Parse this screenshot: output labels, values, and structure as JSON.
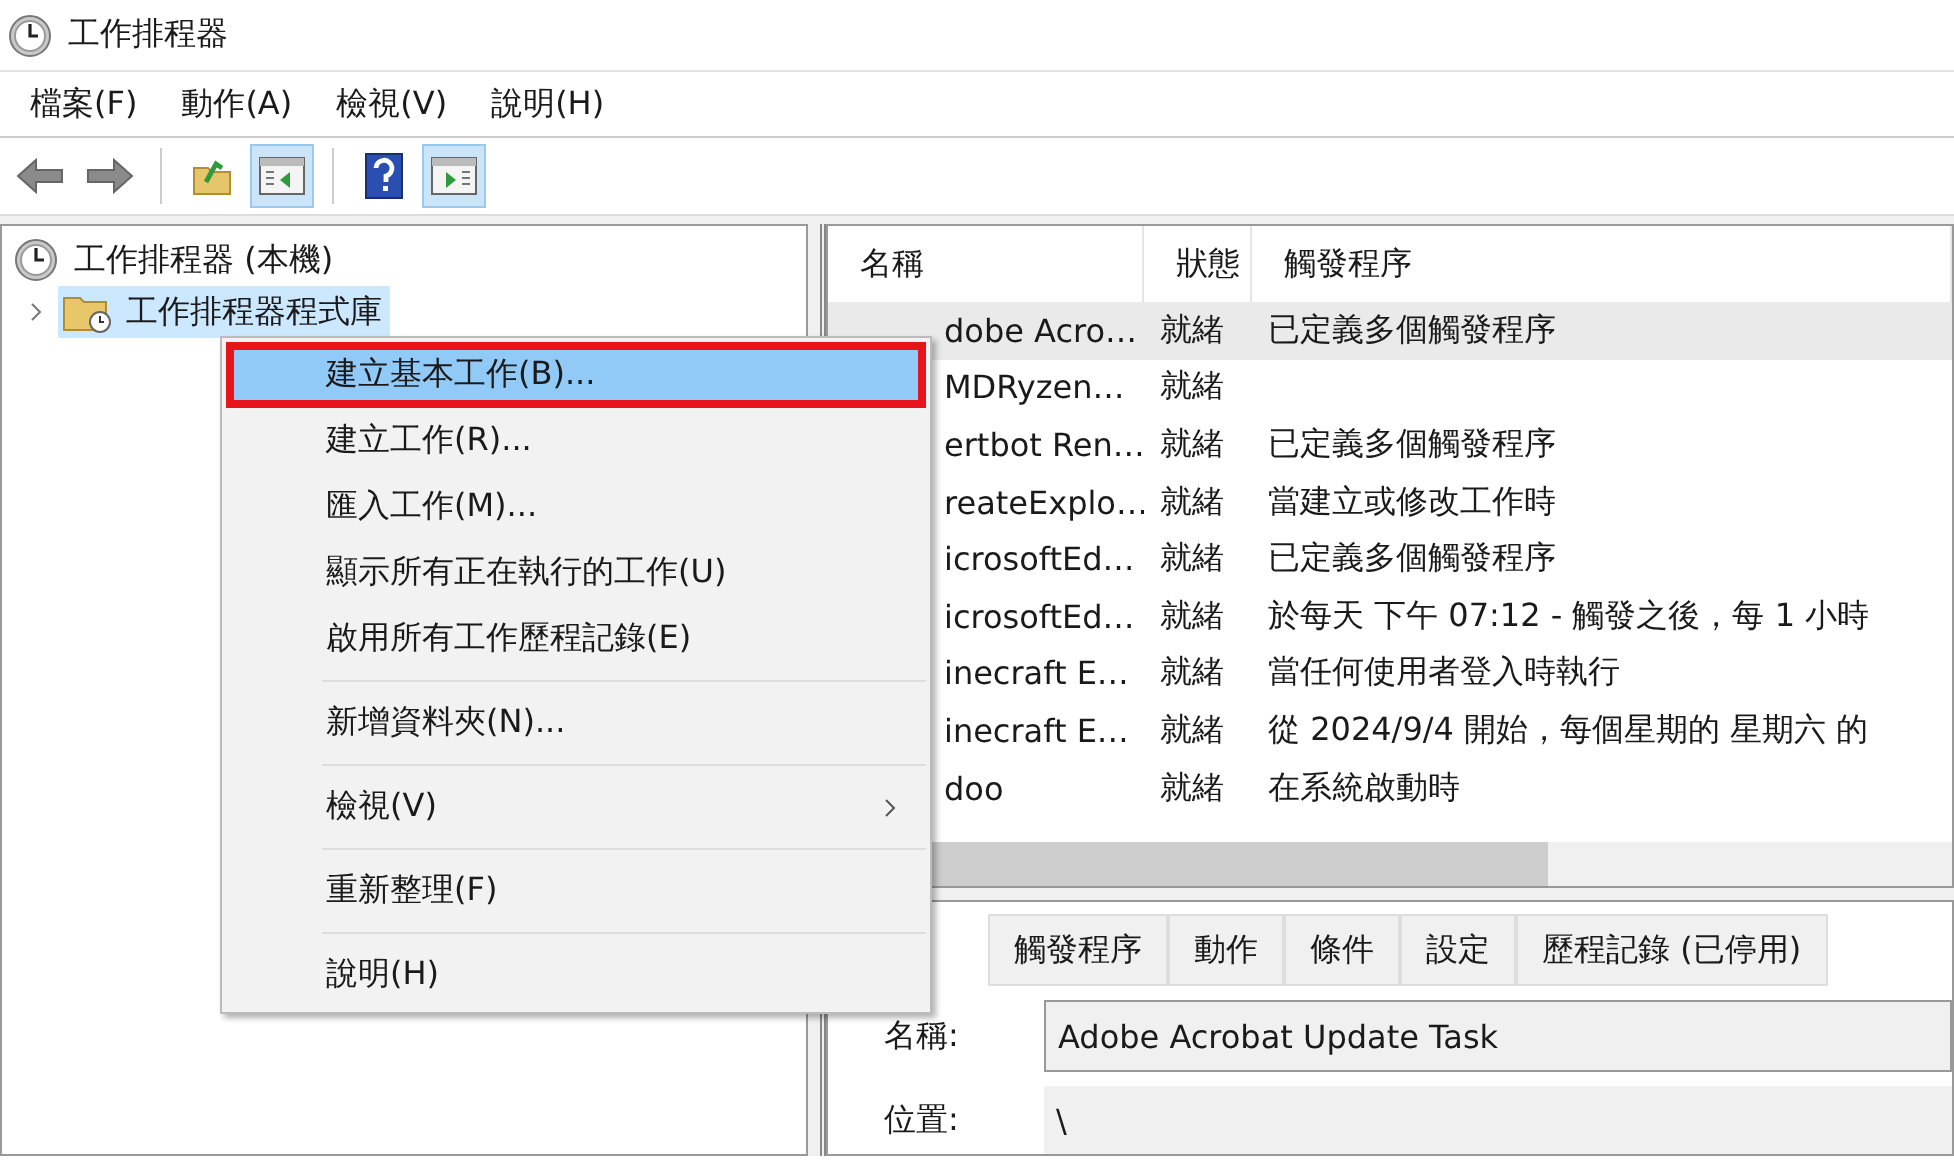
{
  "window": {
    "title": "工作排程器"
  },
  "menu_bar": [
    "檔案(F)",
    "動作(A)",
    "檢視(V)",
    "說明(H)"
  ],
  "toolbar": [
    {
      "kind": "back",
      "on": false
    },
    {
      "kind": "forward",
      "on": false
    },
    {
      "kind": "folder-up",
      "on": false
    },
    {
      "kind": "tree-pane",
      "on": true
    },
    {
      "kind": "help",
      "on": false
    },
    {
      "kind": "action-pane",
      "on": true
    }
  ],
  "tree": {
    "label": "工作排程器 (本機)",
    "children": [
      {
        "label": "工作排程器程式庫",
        "selected": true,
        "expanded": false
      }
    ]
  },
  "task_list": {
    "columns": [
      "名稱",
      "狀態",
      "觸發程序"
    ],
    "rows": [
      {
        "name": "dobe Acro…",
        "status": "就緒",
        "trigger": "已定義多個觸發程序",
        "selected": true
      },
      {
        "name": "MDRyzen…",
        "status": "就緒",
        "selected": false
      },
      {
        "name": "ertbot Ren…",
        "status": "就緒",
        "trigger": "已定義多個觸發程序",
        "selected": false
      },
      {
        "name": "reateExplo…",
        "status": "就緒",
        "trigger": "當建立或修改工作時",
        "selected": false
      },
      {
        "name": "icrosoftEd…",
        "status": "就緒",
        "trigger": "已定義多個觸發程序",
        "selected": false
      },
      {
        "name": "icrosoftEd…",
        "status": "就緒",
        "trigger": "於每天 下午 07:12 - 觸發之後，每 1 小時",
        "selected": false
      },
      {
        "name": "inecraft E…",
        "status": "就緒",
        "trigger": "當任何使用者登入時執行",
        "selected": false
      },
      {
        "name": "inecraft E…",
        "status": "就緒",
        "trigger": "從 2024/9/4 開始，每個星期的 星期六 的",
        "selected": false
      },
      {
        "name": "doo",
        "status": "就緒",
        "trigger": "在系統啟動時",
        "selected": false
      }
    ]
  },
  "context_menu": {
    "groups": [
      [
        {
          "label": "建立基本工作(B)...",
          "selected": true,
          "submenu": false,
          "outlined": true
        },
        {
          "label": "建立工作(R)...",
          "selected": false,
          "submenu": false,
          "outlined": false
        },
        {
          "label": "匯入工作(M)...",
          "selected": false,
          "submenu": false,
          "outlined": false
        },
        {
          "label": "顯示所有正在執行的工作(U)",
          "selected": false,
          "submenu": false,
          "outlined": false
        },
        {
          "label": "啟用所有工作歷程記錄(E)",
          "selected": false,
          "submenu": false,
          "outlined": false
        }
      ],
      [
        {
          "label": "新增資料夾(N)...",
          "selected": false,
          "submenu": false,
          "outlined": false
        }
      ],
      [
        {
          "label": "檢視(V)",
          "selected": false,
          "submenu": true,
          "outlined": false
        }
      ],
      [
        {
          "label": "重新整理(F)",
          "selected": false,
          "submenu": false,
          "outlined": false
        }
      ],
      [
        {
          "label": "說明(H)",
          "selected": false,
          "submenu": false,
          "outlined": false
        }
      ]
    ]
  },
  "detail": {
    "tabs": [
      {
        "label": "觸發程序",
        "selected": false
      },
      {
        "label": "動作",
        "selected": false
      },
      {
        "label": "條件",
        "selected": false
      },
      {
        "label": "設定",
        "selected": false
      },
      {
        "label": "歷程記錄 (已停用)",
        "selected": false
      }
    ],
    "fields": [
      {
        "label": "名稱:",
        "value": "Adobe Acrobat Update Task",
        "kind": "input"
      },
      {
        "label": "位置:",
        "value": "\\",
        "kind": "readonly"
      }
    ]
  }
}
